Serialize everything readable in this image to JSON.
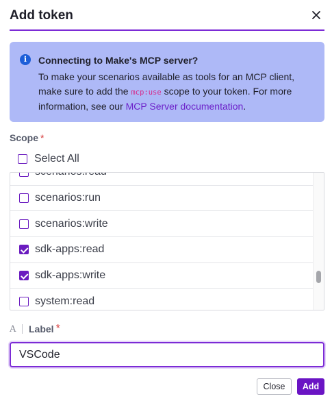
{
  "dialog": {
    "title": "Add token",
    "close_icon": "close-icon"
  },
  "info": {
    "icon": "info-icon",
    "title": "Connecting to Make's MCP server?",
    "body_1": "To make your scenarios available as tools for an MCP client, make sure to add the ",
    "code": "mcp:use",
    "body_2": " scope to your token. For more information, see our ",
    "link": "MCP Server documentation",
    "body_3": "."
  },
  "scope": {
    "label": "Scope",
    "required_mark": "*",
    "select_all": "Select All",
    "items": [
      {
        "label": "scenarios:read",
        "checked": false
      },
      {
        "label": "scenarios:run",
        "checked": false
      },
      {
        "label": "scenarios:write",
        "checked": false
      },
      {
        "label": "sdk-apps:read",
        "checked": true
      },
      {
        "label": "sdk-apps:write",
        "checked": true
      },
      {
        "label": "system:read",
        "checked": false
      }
    ]
  },
  "label_field": {
    "icon": "text-type-icon",
    "label": "Label",
    "required_mark": "*",
    "value": "VSCode"
  },
  "buttons": {
    "close": "Close",
    "add": "Add"
  },
  "colors": {
    "accent": "#7c2bd6",
    "info_bg": "#aeb9f7",
    "checkbox": "#6a1bbf"
  }
}
